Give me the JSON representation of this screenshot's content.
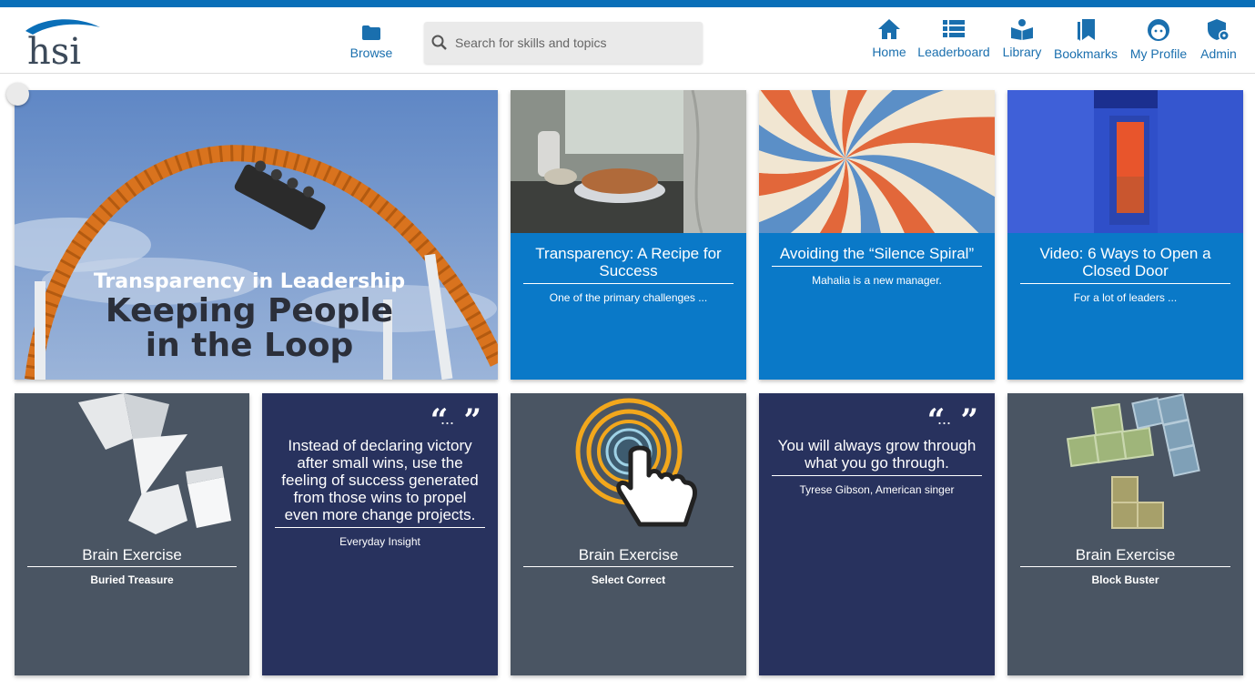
{
  "header": {
    "logo_text": "hsi",
    "browse_label": "Browse",
    "search_placeholder": "Search for skills and topics",
    "nav": [
      {
        "label": "Home",
        "icon": "home-icon"
      },
      {
        "label": "Leaderboard",
        "icon": "leaderboard-icon"
      },
      {
        "label": "Library",
        "icon": "library-icon"
      },
      {
        "label": "Bookmarks",
        "icon": "bookmarks-icon"
      },
      {
        "label": "My Profile",
        "icon": "profile-icon"
      },
      {
        "label": "Admin",
        "icon": "admin-icon"
      }
    ]
  },
  "colors": {
    "brand_blue": "#0a6fb8",
    "card_blue": "#0a79c8",
    "slate": "#4a5563",
    "navy": "#28325e"
  },
  "hero": {
    "title_line": "Transparency in Leadership",
    "subtitle_line1": "Keeping People",
    "subtitle_line2": "in the Loop"
  },
  "row1_cards": [
    {
      "title": "Transparency: A Recipe for Success",
      "sub": "One of the primary challenges ..."
    },
    {
      "title": "Avoiding the “Silence Spiral”",
      "sub": "Mahalia is a new manager."
    },
    {
      "title": "Video: 6 Ways to Open a Closed Door",
      "sub": "For a lot of leaders ..."
    }
  ],
  "row2_cards": [
    {
      "kind": "brain",
      "title": "Brain Exercise",
      "sub": "Buried Treasure"
    },
    {
      "kind": "quote",
      "quote": "Instead of declaring victory after small wins, use the feeling of success generated from those wins to propel even more change projects.",
      "source": "Everyday Insight"
    },
    {
      "kind": "brain",
      "title": "Brain Exercise",
      "sub": "Select Correct"
    },
    {
      "kind": "quote",
      "quote": "You will always grow through what you go through.",
      "source": "Tyrese Gibson, American singer"
    },
    {
      "kind": "brain",
      "title": "Brain Exercise",
      "sub": "Block Buster"
    }
  ],
  "quote_glyphs": {
    "open": "“",
    "dots": "...",
    "close": "”"
  }
}
